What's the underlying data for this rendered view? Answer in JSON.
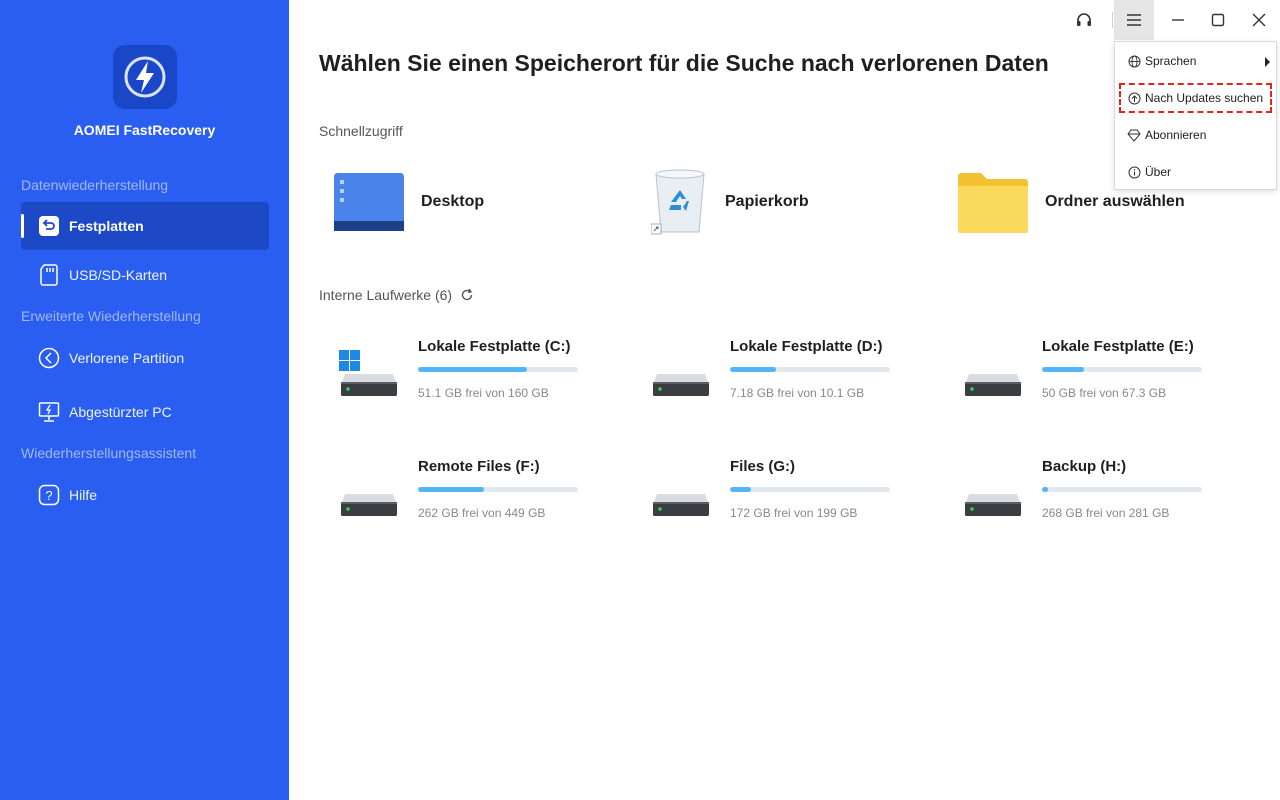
{
  "app": {
    "name": "AOMEI FastRecovery"
  },
  "sidebar": {
    "sections": [
      {
        "label": "Datenwiederherstellung"
      },
      {
        "label": "Erweiterte Wiederherstellung"
      },
      {
        "label": "Wiederherstellungsassistent"
      }
    ],
    "items": [
      {
        "label": "Festplatten",
        "icon": "disk-restore-icon",
        "active": true
      },
      {
        "label": "USB/SD-Karten",
        "icon": "sd-card-icon"
      },
      {
        "label": "Verlorene Partition",
        "icon": "partition-icon"
      },
      {
        "label": "Abgestürzter PC",
        "icon": "crashed-pc-icon"
      },
      {
        "label": "Hilfe",
        "icon": "help-icon"
      }
    ]
  },
  "main": {
    "title": "Wählen Sie einen Speicherort für die Suche nach verlorenen Daten",
    "quick_access": {
      "label": "Schnellzugriff",
      "items": [
        {
          "label": "Desktop",
          "icon": "desktop-icon"
        },
        {
          "label": "Papierkorb",
          "icon": "recycle-bin-icon"
        },
        {
          "label": "Ordner auswählen",
          "icon": "folder-icon"
        }
      ]
    },
    "drives": {
      "label": "Interne Laufwerke (6)",
      "items": [
        {
          "name": "Lokale Festplatte (C:)",
          "info": "51.1 GB frei von 160 GB",
          "used_fraction": 0.68,
          "system": true
        },
        {
          "name": "Lokale Festplatte (D:)",
          "info": "7.18 GB frei von 10.1 GB",
          "used_fraction": 0.29
        },
        {
          "name": "Lokale Festplatte (E:)",
          "info": "50 GB frei von 67.3 GB",
          "used_fraction": 0.26
        },
        {
          "name": "Remote Files (F:)",
          "info": "262 GB frei von 449 GB",
          "used_fraction": 0.41
        },
        {
          "name": "Files (G:)",
          "info": "172 GB frei von 199 GB",
          "used_fraction": 0.13
        },
        {
          "name": "Backup (H:)",
          "info": "268 GB frei von 281 GB",
          "used_fraction": 0.04
        }
      ]
    }
  },
  "menu": {
    "items": [
      {
        "label": "Sprachen",
        "icon": "globe-icon",
        "has_submenu": true
      },
      {
        "label": "Nach Updates suchen",
        "icon": "update-icon",
        "highlighted": true
      },
      {
        "label": "Abonnieren",
        "icon": "diamond-icon"
      },
      {
        "label": "Über",
        "icon": "info-icon"
      }
    ]
  },
  "colors": {
    "sidebar_bg": "#2a5ef0",
    "active_item_bg": "#1d49c7",
    "progress": "#52b5f5",
    "highlight_border": "#e1251b"
  }
}
